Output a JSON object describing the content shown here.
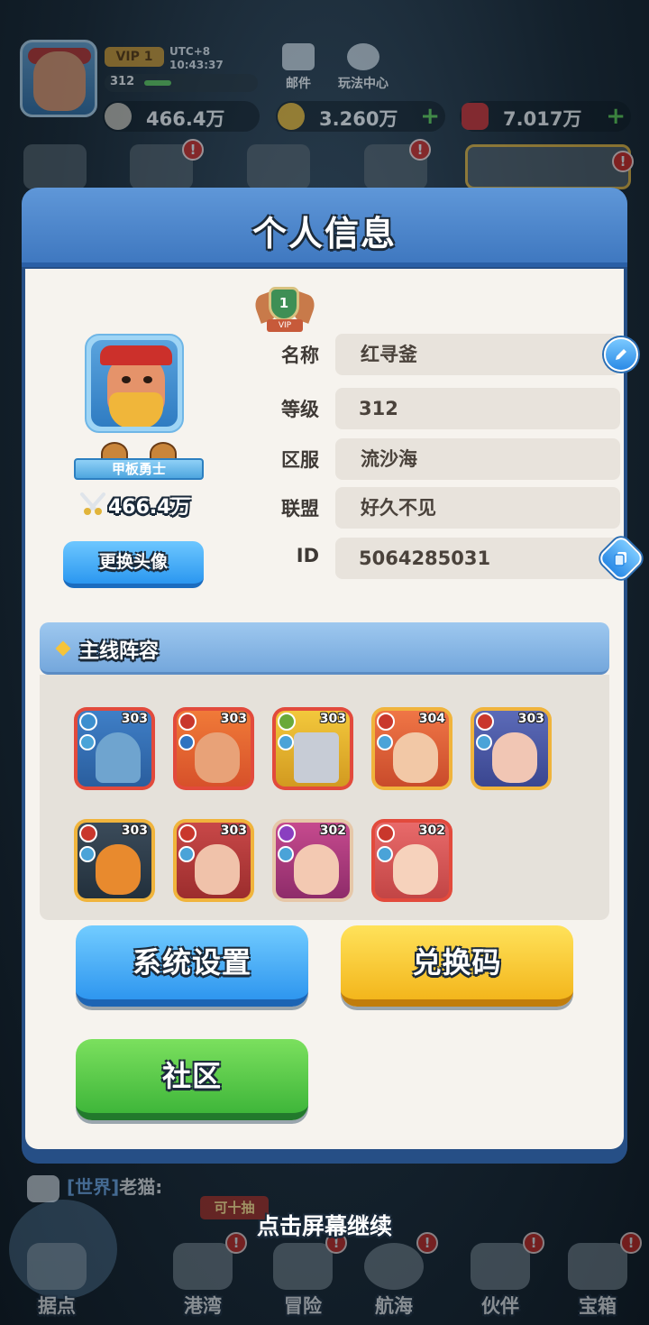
{
  "hud": {
    "vip": "VIP 1",
    "timezone": "UTC+8",
    "time": "10:43:37",
    "level": "312",
    "mail_label": "邮件",
    "guide_label": "玩法中心",
    "power": "466.4万",
    "gold": "3.260万",
    "gems": "7.017万"
  },
  "panel": {
    "title": "个人信息",
    "vip_level": "1",
    "vip_tag": "VIP",
    "player_title": "甲板勇士",
    "power": "466.4万",
    "change_avatar": "更换头像",
    "fields": [
      {
        "key": "名称",
        "value": "红寻釜"
      },
      {
        "key": "等级",
        "value": "312"
      },
      {
        "key": "区服",
        "value": "流沙海"
      },
      {
        "key": "联盟",
        "value": "好久不见"
      },
      {
        "key": "ID",
        "value": "5064285031"
      }
    ],
    "lineup_title": "主线阵容",
    "heroes": [
      {
        "level": "303",
        "frame": "red"
      },
      {
        "level": "303",
        "frame": "red"
      },
      {
        "level": "303",
        "frame": "red"
      },
      {
        "level": "304",
        "frame": "orange"
      },
      {
        "level": "303",
        "frame": "orange"
      },
      {
        "level": "303",
        "frame": "orange"
      },
      {
        "level": "303",
        "frame": "orange"
      },
      {
        "level": "302",
        "frame": "orange"
      },
      {
        "level": "302",
        "frame": "red"
      }
    ],
    "settings_button": "系统设置",
    "redeem_button": "兑换码",
    "community_button": "社区"
  },
  "chat": {
    "channel": "[世界]",
    "sender": "老猫:"
  },
  "ribbon": "可十抽",
  "tap_hint": "点击屏幕继续",
  "nav": [
    {
      "label": "据点"
    },
    {
      "label": "港湾"
    },
    {
      "label": "冒险"
    },
    {
      "label": "航海"
    },
    {
      "label": "伙伴"
    },
    {
      "label": "宝箱"
    }
  ],
  "badge": "!"
}
